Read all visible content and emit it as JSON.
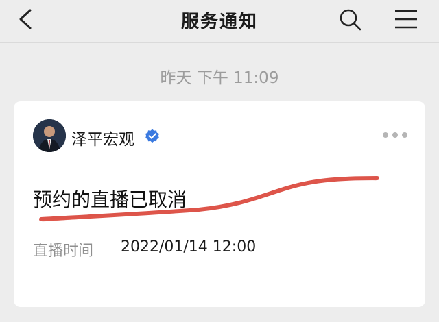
{
  "nav": {
    "title": "服务通知",
    "back_icon": "chevron-left-icon",
    "search_icon": "search-icon",
    "menu_icon": "menu-icon"
  },
  "timestamp": "昨天 下午 11:09",
  "card": {
    "account_name": "泽平宏观",
    "verified_icon": "verified-badge-icon",
    "more_icon": "more-icon",
    "title": "预约的直播已取消",
    "fields": [
      {
        "label": "直播时间",
        "value": "2022/01/14 12:00"
      }
    ],
    "colors": {
      "verified": "#3b7ae0",
      "scribble": "#d6362a"
    }
  }
}
